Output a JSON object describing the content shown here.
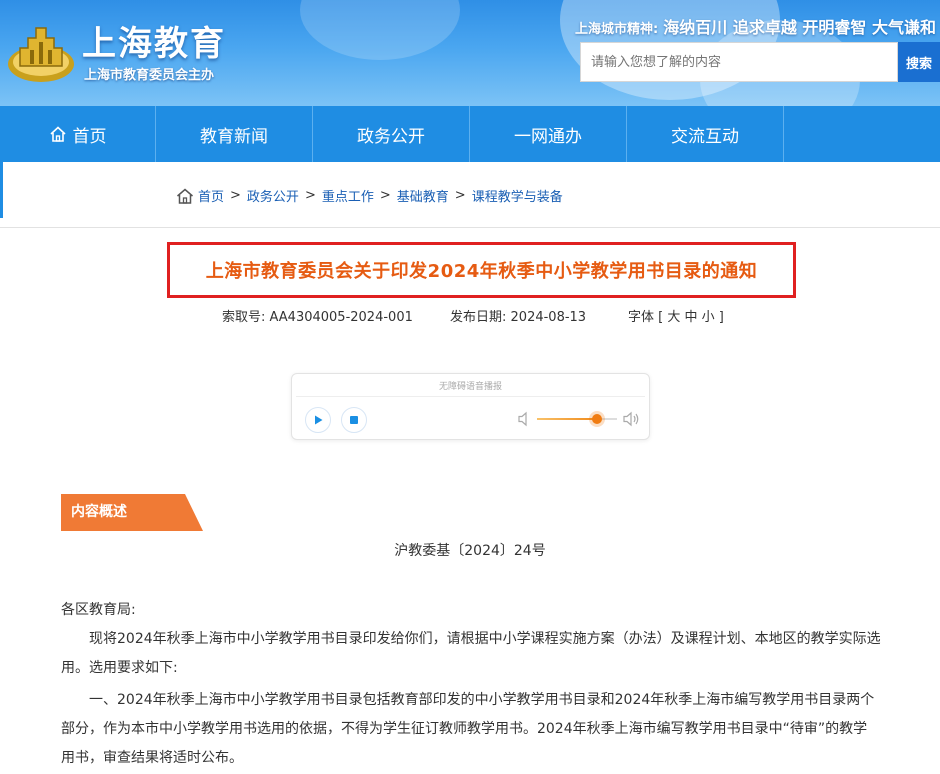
{
  "header": {
    "site_title": "上海教育",
    "site_subtitle": "上海市教育委员会主办",
    "spirit_label": "上海城市精神:",
    "spirit_value": "海纳百川 追求卓越 开明睿智 大气谦和",
    "search_placeholder": "请输入您想了解的内容",
    "search_button": "搜索"
  },
  "nav": {
    "items": [
      {
        "label": "首页",
        "icon": "home-icon"
      },
      {
        "label": "教育新闻"
      },
      {
        "label": "政务公开"
      },
      {
        "label": "一网通办"
      },
      {
        "label": "交流互动"
      }
    ]
  },
  "breadcrumb": {
    "items": [
      "首页",
      "政务公开",
      "重点工作",
      "基础教育",
      "课程教学与装备"
    ],
    "separator": ">"
  },
  "article": {
    "title": "上海市教育委员会关于印发2024年秋季中小学教学用书目录的通知",
    "index_label": "索取号:",
    "index_value": "AA4304005-2024-001",
    "date_label": "发布日期:",
    "date_value": "2024-08-13",
    "font_label": "字体 [ 大 中 小 ]",
    "player_title": "无障碍语音播报",
    "volume_level": 0.75,
    "section_tag": "内容概述",
    "doc_number": "沪教委基〔2024〕24号",
    "salutation": "各区教育局:",
    "para1": "现将2024年秋季上海市中小学教学用书目录印发给你们，请根据中小学课程实施方案（办法）及课程计划、本地区的教学实际选用。选用要求如下:",
    "para2": "一、2024年秋季上海市中小学教学用书目录包括教育部印发的中小学教学用书目录和2024年秋季上海市编写教学用书目录两个部分，作为本市中小学教学用书选用的依据，不得为学生征订教师教学用书。2024年秋季上海市编写教学用书目录中“待审”的教学用书，审查结果将适时公布。"
  },
  "colors": {
    "nav_blue": "#1f8de3",
    "title_orange": "#e65b12",
    "title_border": "#e02020",
    "tag_orange": "#f07a35"
  }
}
